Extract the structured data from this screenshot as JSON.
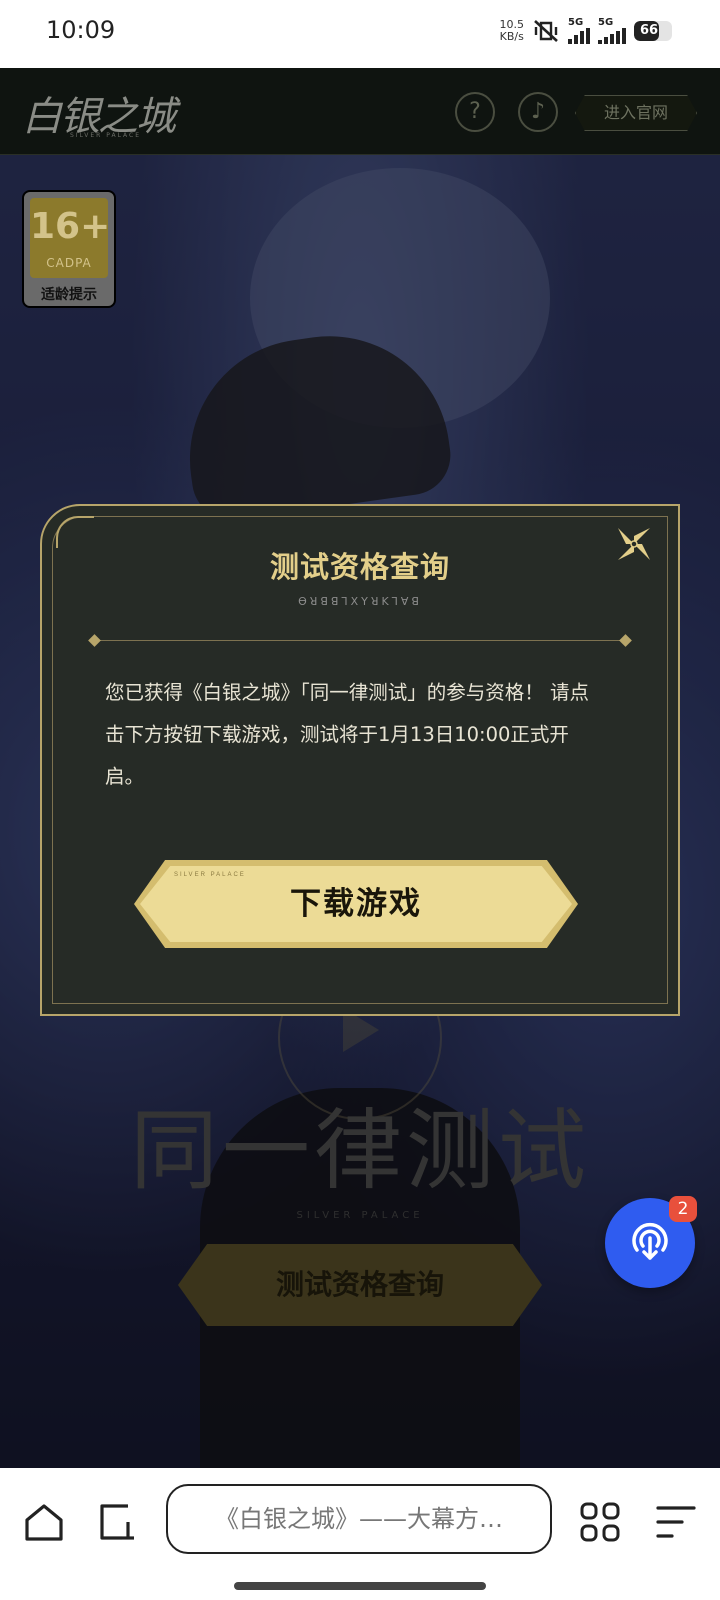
{
  "status_bar": {
    "time": "10:09",
    "net_speed_value": "10.5",
    "net_speed_unit": "KB/s",
    "sim1_label": "5G",
    "sim2_label": "5G",
    "battery_percent": "66",
    "battery_level": 0.66
  },
  "site_header": {
    "logo": "白银之城",
    "logo_sub": "SILVER PALACE",
    "help_icon": "?",
    "music_icon": "♪",
    "enter_site": "进入官网"
  },
  "age_badge": {
    "rating": "16+",
    "org": "CADPA",
    "label": "适龄提示"
  },
  "page": {
    "big_title": "同一律测试",
    "big_title_sub": "SILVER PALACE",
    "query_button": "测试资格查询",
    "fab_badge_count": "2"
  },
  "modal": {
    "title": "测试资格查询",
    "subtitle": "Ɵꓤꓭꓭꓶꓫꓬꓤꓗꓶꓯꓭ",
    "body": "您已获得《白银之城》「同一律测试」的参与资格！ 请点击下方按钮下载游戏，测试将于1月13日10:00正式开启。",
    "download_button": "下载游戏",
    "download_button_small": "SILVER PALACE"
  },
  "browser": {
    "url_title": "《白银之城》——大幕方…"
  },
  "colors": {
    "gold": "#e3cf8a",
    "modal_bg": "#262b26",
    "fab_blue": "#2f5cf0",
    "badge_red": "#e8503c"
  }
}
